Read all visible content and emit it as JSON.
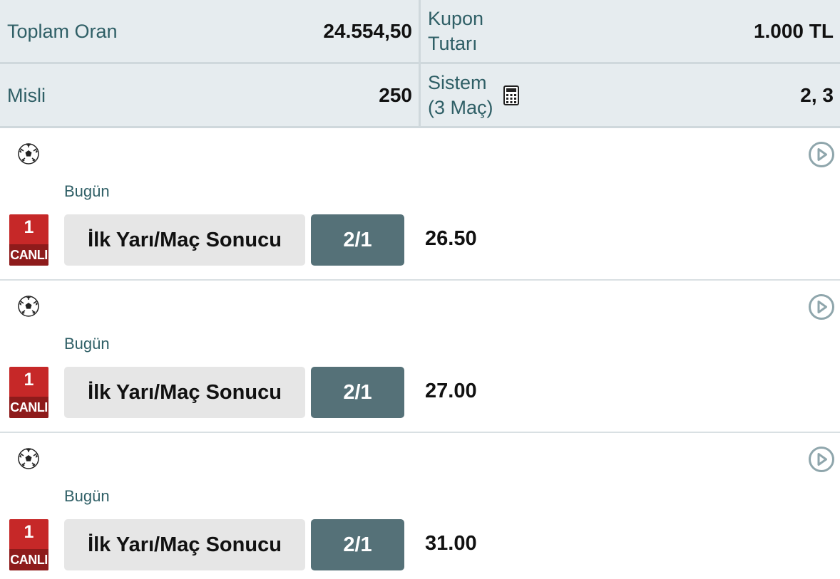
{
  "summary": {
    "total_odds_label": "Toplam Oran",
    "total_odds_value": "24.554,50",
    "coupon_amount_label_line1": "Kupon",
    "coupon_amount_label_line2": "Tutarı",
    "coupon_amount_value": "1.000 TL",
    "multiplier_label": "Misli",
    "multiplier_value": "250",
    "system_label_line1": "Sistem",
    "system_label_line2": "(3 Maç)",
    "system_icon": "calculator-icon",
    "system_value": "2, 3"
  },
  "matches": [
    {
      "sport_icon": "soccer-ball-icon",
      "date": "Bugün",
      "live_number": "1",
      "live_label": "CANLI",
      "market": "İlk Yarı/Maç Sonucu",
      "pick": "2/1",
      "odds": "26.50",
      "action_icon": "play-circle-icon"
    },
    {
      "sport_icon": "soccer-ball-icon",
      "date": "Bugün",
      "live_number": "1",
      "live_label": "CANLI",
      "market": "İlk Yarı/Maç Sonucu",
      "pick": "2/1",
      "odds": "27.00",
      "action_icon": "play-circle-icon"
    },
    {
      "sport_icon": "soccer-ball-icon",
      "date": "Bugün",
      "live_number": "1",
      "live_label": "CANLI",
      "market": "İlk Yarı/Maç Sonucu",
      "pick": "2/1",
      "odds": "31.00",
      "action_icon": "play-circle-icon"
    }
  ],
  "colors": {
    "label_teal": "#2f5f66",
    "summary_bg": "#e6ecef",
    "live_red": "#c62828",
    "pick_bg": "#557178",
    "market_bg": "#e6e6e6"
  }
}
